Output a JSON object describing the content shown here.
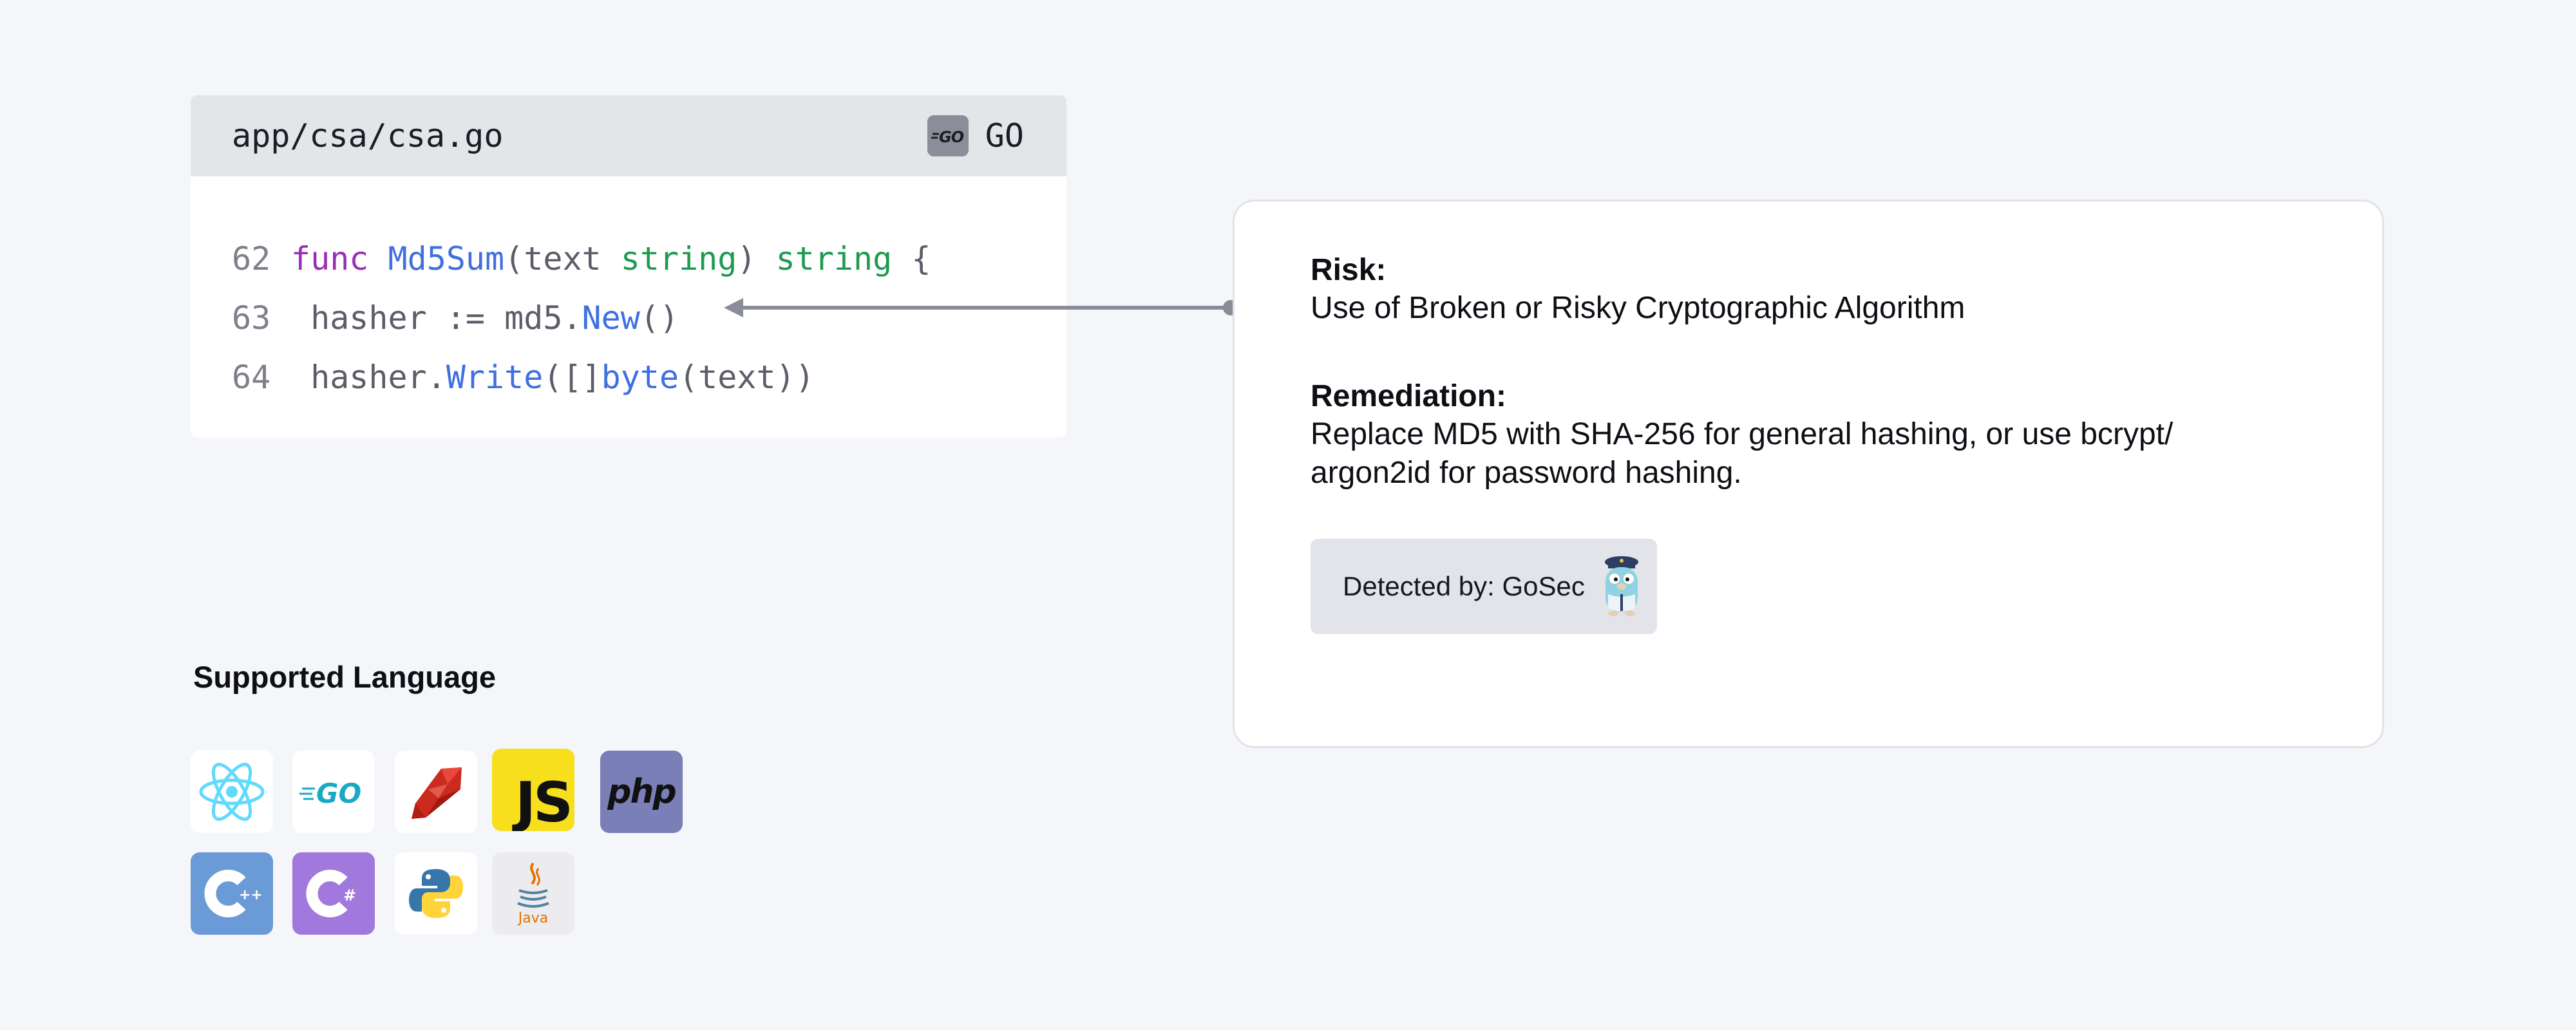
{
  "code_card": {
    "file_path": "app/csa/csa.go",
    "language_badge_icon": "go-gopher-badge",
    "language_badge_text": "GO",
    "language": "GO",
    "lines": [
      {
        "number": "62",
        "tokens": [
          {
            "text": "func ",
            "kind": "keyword"
          },
          {
            "text": "Md5Sum",
            "kind": "function"
          },
          {
            "text": "(text ",
            "kind": "plain"
          },
          {
            "text": "string",
            "kind": "type"
          },
          {
            "text": ") ",
            "kind": "plain"
          },
          {
            "text": "string",
            "kind": "type"
          },
          {
            "text": " {",
            "kind": "plain"
          }
        ]
      },
      {
        "number": "63",
        "tokens": [
          {
            "text": " hasher := md5.",
            "kind": "plain"
          },
          {
            "text": "New",
            "kind": "function"
          },
          {
            "text": "()",
            "kind": "plain"
          }
        ]
      },
      {
        "number": "64",
        "tokens": [
          {
            "text": " hasher.",
            "kind": "plain"
          },
          {
            "text": "Write",
            "kind": "function"
          },
          {
            "text": "([]",
            "kind": "plain"
          },
          {
            "text": "byte",
            "kind": "function"
          },
          {
            "text": "(text))",
            "kind": "plain"
          }
        ]
      }
    ],
    "colors": {
      "keyword": "#9a2fb5",
      "function": "#3f6fe0",
      "type": "#1f9a52",
      "plain": "#5b5e68"
    }
  },
  "risk_card": {
    "risk_label": "Risk:",
    "risk_text": "Use of Broken or Risky Cryptographic Algorithm",
    "remediation_label": "Remediation:",
    "remediation_text": "Replace MD5 with SHA-256 for general hashing, or use bcrypt/ argon2id for password hashing.",
    "detected_by": "Detected by: GoSec",
    "detector_icon": "gosec-gopher-icon"
  },
  "supported_languages": {
    "title": "Supported Language",
    "icons": [
      {
        "name": "react-icon",
        "color": "#61dafb"
      },
      {
        "name": "go-icon",
        "text": "GO",
        "color": "#1aa9c4"
      },
      {
        "name": "ruby-icon",
        "color": "#cc2a1e"
      },
      {
        "name": "javascript-icon",
        "text": "JS",
        "color": "#f7df1e"
      },
      {
        "name": "php-icon",
        "text": "php",
        "color": "#7a7fb8"
      },
      {
        "name": "cplusplus-icon",
        "text": "C++",
        "color": "#6a9bd6"
      },
      {
        "name": "csharp-icon",
        "text": "C#",
        "color": "#a179dc"
      },
      {
        "name": "python-icon",
        "color": "#3776ab"
      },
      {
        "name": "java-icon",
        "text": "Java",
        "color": "#e76f00"
      }
    ]
  },
  "connector": {
    "color": "#8a8c97"
  }
}
